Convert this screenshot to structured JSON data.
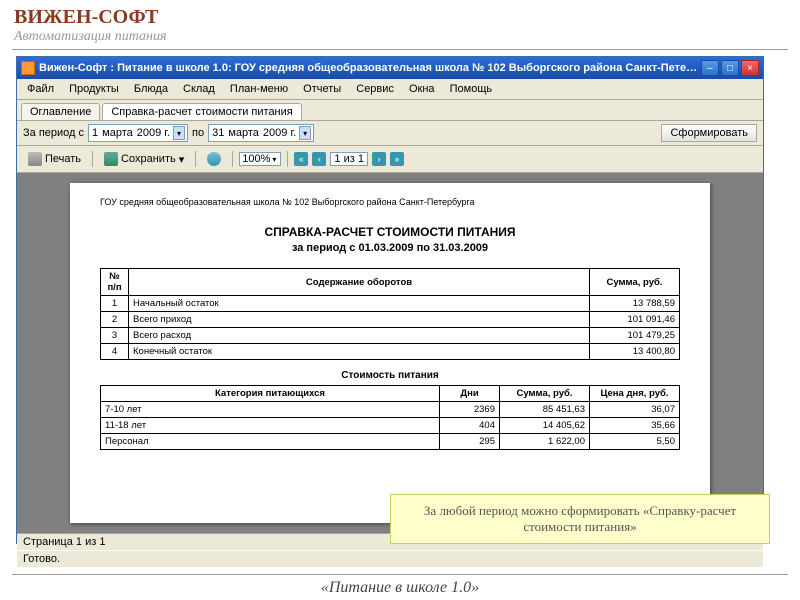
{
  "slide": {
    "brand": "ВИЖЕН-СОФТ",
    "tagline": "Автоматизация питания",
    "product": "«Питание в школе 1.0»",
    "callout": "За любой период можно сформировать «Справку-расчет стоимости питания»"
  },
  "window": {
    "title": "Вижен-Софт : Питание в школе 1.0: ГОУ средняя общеобразовательная школа № 102 Выборгского района Санкт-Петербурга"
  },
  "menu": {
    "file": "Файл",
    "products": "Продукты",
    "dishes": "Блюда",
    "warehouse": "Склад",
    "planmenu": "План-меню",
    "reports": "Отчеты",
    "service": "Сервис",
    "window": "Окна",
    "help": "Помощь"
  },
  "tabs": {
    "toc": "Оглавление",
    "report": "Справка-расчет стоимости питания"
  },
  "filter": {
    "label": "За период с",
    "from_day": "1",
    "from_month": "марта",
    "from_year": "2009 г.",
    "to_label": "по",
    "to_day": "31",
    "to_month": "марта",
    "to_year": "2009 г.",
    "generate": "Сформировать"
  },
  "toolbar": {
    "print": "Печать",
    "save": "Сохранить",
    "zoom": "100%",
    "page": "1 из 1"
  },
  "report": {
    "school": "ГОУ средняя общеобразовательная школа № 102 Выборгского района Санкт-Петербурга",
    "title": "СПРАВКА-РАСЧЕТ СТОИМОСТИ ПИТАНИЯ",
    "subtitle": "за период с 01.03.2009 по 31.03.2009",
    "t1": {
      "h_num": "№ п/п",
      "h_desc": "Содержание оборотов",
      "h_sum": "Сумма, руб.",
      "rows": [
        {
          "n": "1",
          "d": "Начальный остаток",
          "s": "13 788,59"
        },
        {
          "n": "2",
          "d": "Всего приход",
          "s": "101 091,46"
        },
        {
          "n": "3",
          "d": "Всего расход",
          "s": "101 479,25"
        },
        {
          "n": "4",
          "d": "Конечный остаток",
          "s": "13 400,80"
        }
      ]
    },
    "t2": {
      "title": "Стоимость питания",
      "h_cat": "Категория питающихся",
      "h_days": "Дни",
      "h_sum": "Сумма, руб.",
      "h_price": "Цена дня, руб.",
      "rows": [
        {
          "c": "7-10 лет",
          "d": "2369",
          "s": "85 451,63",
          "p": "36,07"
        },
        {
          "c": "11-18 лет",
          "d": "404",
          "s": "14 405,62",
          "p": "35,66"
        },
        {
          "c": "Персонал",
          "d": "295",
          "s": "1 622,00",
          "p": "5,50"
        }
      ]
    }
  },
  "status": {
    "page": "Страница 1 из 1",
    "ready": "Готово."
  }
}
